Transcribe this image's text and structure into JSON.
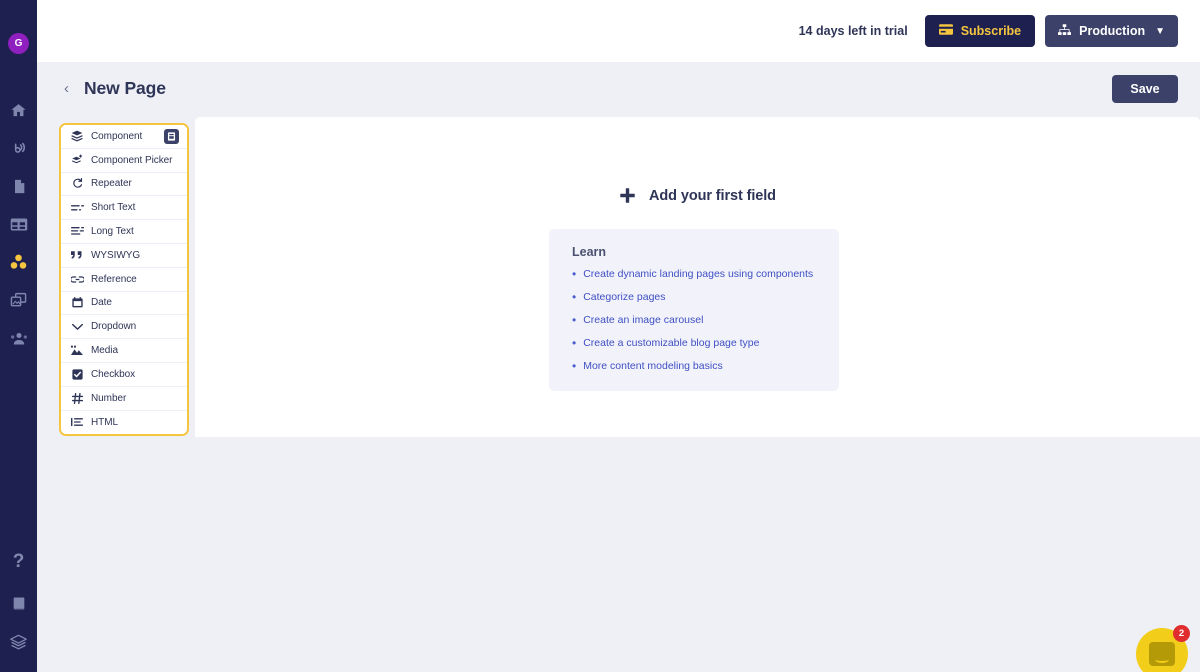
{
  "rail": {
    "avatar_initial": "G",
    "top_items": [
      {
        "name": "home-icon",
        "label": "Home"
      },
      {
        "name": "broadcast-icon",
        "label": "Broadcast"
      },
      {
        "name": "document-icon",
        "label": "Documents"
      },
      {
        "name": "table-icon",
        "label": "Tables"
      },
      {
        "name": "components-icon",
        "label": "Components"
      },
      {
        "name": "media-icon",
        "label": "Media"
      },
      {
        "name": "users-icon",
        "label": "Users"
      }
    ],
    "active_index": 4,
    "bottom_items": [
      {
        "name": "help-icon",
        "label": "Help"
      },
      {
        "name": "book-icon",
        "label": "Docs"
      },
      {
        "name": "layers-icon",
        "label": "Layers"
      }
    ]
  },
  "topbar": {
    "trial_text": "14 days left in trial",
    "subscribe_label": "Subscribe",
    "environment_label": "Production",
    "accent_color": "#f5c53f",
    "bar_background": "#ffffff"
  },
  "page_header": {
    "back_label": "‹",
    "title": "New Page",
    "save_label": "Save"
  },
  "field_panel": {
    "border_color": "#f5c53f",
    "items": [
      {
        "icon": "layers-stack-icon",
        "label": "Component",
        "badge": true
      },
      {
        "icon": "component-picker-icon",
        "label": "Component Picker",
        "badge": false
      },
      {
        "icon": "repeater-icon",
        "label": "Repeater",
        "badge": false
      },
      {
        "icon": "short-text-icon",
        "label": "Short Text",
        "badge": false
      },
      {
        "icon": "long-text-icon",
        "label": "Long Text",
        "badge": false
      },
      {
        "icon": "quote-icon",
        "label": "WYSIWYG",
        "badge": false
      },
      {
        "icon": "reference-link-icon",
        "label": "Reference",
        "badge": false
      },
      {
        "icon": "calendar-icon",
        "label": "Date",
        "badge": false
      },
      {
        "icon": "chevron-down-icon",
        "label": "Dropdown",
        "badge": false
      },
      {
        "icon": "image-icon",
        "label": "Media",
        "badge": false
      },
      {
        "icon": "checkbox-icon",
        "label": "Checkbox",
        "badge": false
      },
      {
        "icon": "hash-icon",
        "label": "Number",
        "badge": false
      },
      {
        "icon": "list-icon",
        "label": "HTML",
        "badge": false
      }
    ]
  },
  "main": {
    "add_field_label": "Add your first field",
    "add_field_icon": "plus-icon",
    "learn": {
      "title": "Learn",
      "links": [
        "Create dynamic landing pages using components",
        "Categorize pages",
        "Create an image carousel",
        "Create a customizable blog page type",
        "More content modeling basics"
      ]
    }
  },
  "chat": {
    "badge_count": "2",
    "color": "#f2ce1b"
  }
}
